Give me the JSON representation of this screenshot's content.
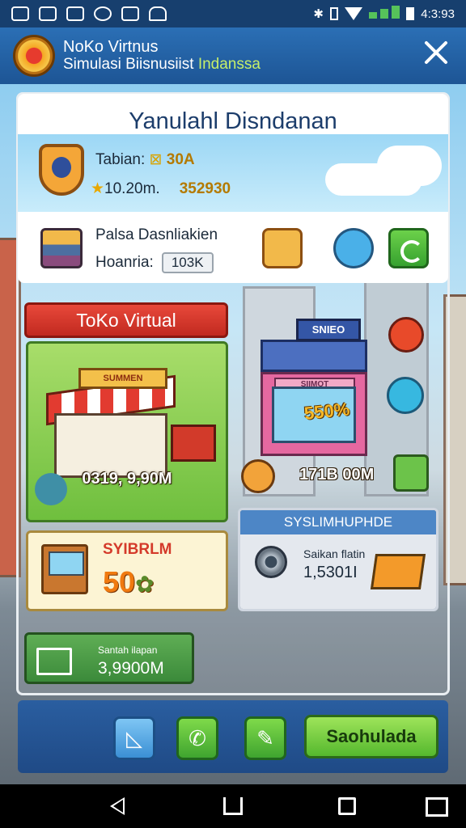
{
  "status_bar": {
    "icons": [
      "mail-icon",
      "gallery-icon",
      "photo-icon",
      "chat-icon",
      "notification-icon",
      "android-icon"
    ],
    "right_icons": [
      "bluetooth-icon",
      "vibrate-icon",
      "wifi-icon",
      "signal-icon",
      "battery-icon"
    ],
    "time": "4:3:93"
  },
  "header": {
    "title": "NoKo Virtnus",
    "subtitle_main": "Simulasi Biisnusiist",
    "subtitle_highlight": "Indanssa",
    "close_icon": "close-icon"
  },
  "top_card": {
    "title": "Yanulahl Disndanan",
    "stat1_label": "Tabian:",
    "stat1_value": "30A",
    "stat2_label": "10.20m.",
    "stat2_value": "352930",
    "row_label1": "Palsa Dasnliakien",
    "row_label2": "Hoanria:",
    "row_value2": "103K"
  },
  "shop": {
    "banner": "ToKo Virtual",
    "sign": "SUMMEN",
    "value": "0319, 9,90M"
  },
  "building": {
    "sign": "SNIEO",
    "storefront": "SIIMOT",
    "percent": "550%",
    "value": "171B 00M"
  },
  "sale_card": {
    "label": "SYIBRLM",
    "percent": "50"
  },
  "system_card": {
    "header": "SYSLIMHUPHDE",
    "label": "Saikan flatin",
    "value": "1,5301I"
  },
  "bottom_card": {
    "label": "Santah ilapan",
    "value": "3,9900M"
  },
  "toolbar": {
    "edit_icon": "edit-icon",
    "call_icon": "phone-icon",
    "pen_icon": "pencil-icon",
    "save_label": "Saohulada"
  },
  "colors": {
    "header_blue": "#1d5595",
    "accent_green": "#55b82e",
    "banner_red": "#c12a20",
    "sale_orange": "#f07a10"
  }
}
